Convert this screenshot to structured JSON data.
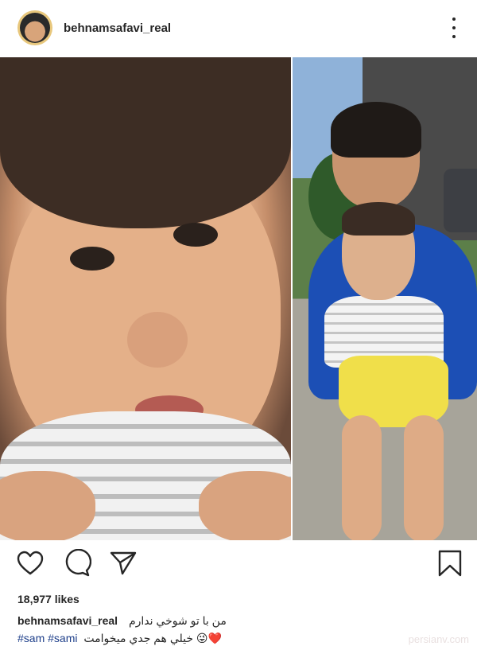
{
  "header": {
    "username": "behnamsafavi_real"
  },
  "post": {
    "likes": "18,977 likes",
    "caption_user": "behnamsafavi_real",
    "caption_text": "من با تو شوخي ندارم",
    "hashtags": [
      "#sam",
      "#sami"
    ],
    "caption_text_2": "خيلي هم جدي ميخوامت",
    "emoji": "😜❤️"
  },
  "watermark": "persianv.com",
  "icons": {
    "avatar": "avatar-photo",
    "more": "more-vertical-icon",
    "like": "heart-icon",
    "comment": "comment-icon",
    "share": "send-icon",
    "save": "bookmark-icon"
  }
}
